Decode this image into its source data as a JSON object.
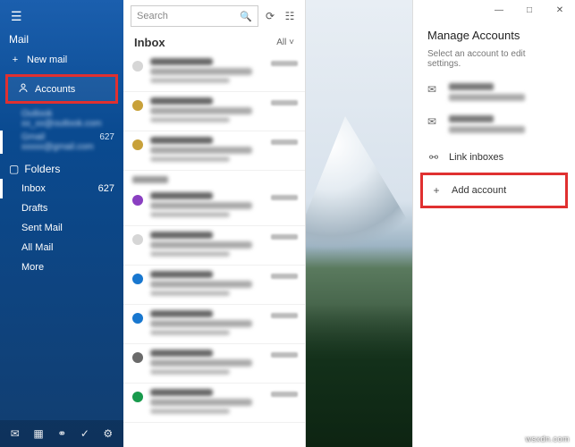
{
  "app_title": "Mail",
  "titlebar": {
    "min": "—",
    "max": "□",
    "close": "✕"
  },
  "sidebar": {
    "new_mail": "New mail",
    "accounts": "Accounts",
    "acct_sub": [
      {
        "name": "Outlook",
        "email": "xx_xx@outlook.com",
        "active": false
      },
      {
        "name": "Gmail",
        "email": "xxxxx@gmail.com",
        "badge": "627",
        "active": true
      }
    ],
    "folders_label": "Folders",
    "folders": [
      {
        "name": "Inbox",
        "count": "627",
        "active": true
      },
      {
        "name": "Drafts"
      },
      {
        "name": "Sent Mail"
      },
      {
        "name": "All Mail"
      },
      {
        "name": "More"
      }
    ]
  },
  "list": {
    "search_placeholder": "Search",
    "header": "Inbox",
    "filter": "All ˅",
    "messages": [
      {
        "color": "#d6d6d6"
      },
      {
        "color": "#c8a13a"
      },
      {
        "color": "#c8a13a"
      },
      {
        "color": "#8a3fc1",
        "section": true
      },
      {
        "color": "#d6d6d6"
      },
      {
        "color": "#1877cf"
      },
      {
        "color": "#1877cf"
      },
      {
        "color": "#6a6a6a"
      },
      {
        "color": "#189a4c"
      }
    ]
  },
  "rightpane": {
    "title": "Manage Accounts",
    "hint": "Select an account to edit settings.",
    "link_inboxes": "Link inboxes",
    "add_account": "Add account"
  },
  "watermark": "wsxdn.com"
}
